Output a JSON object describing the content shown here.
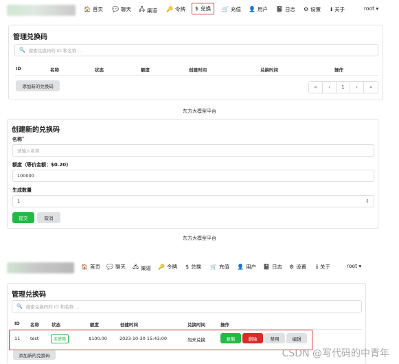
{
  "nav": {
    "items": [
      {
        "icon": "home-icon",
        "glyph": "🏠",
        "label": "首页"
      },
      {
        "icon": "chat-icon",
        "glyph": "💬",
        "label": "聊天"
      },
      {
        "icon": "sitemap-icon",
        "glyph": "🖧",
        "label": "渠道"
      },
      {
        "icon": "key-icon",
        "glyph": "🔑",
        "label": "令牌"
      },
      {
        "icon": "dollar-icon",
        "glyph": "$",
        "label": "兑换"
      },
      {
        "icon": "cart-icon",
        "glyph": "🛒",
        "label": "充值"
      },
      {
        "icon": "user-icon",
        "glyph": "👤",
        "label": "用户"
      },
      {
        "icon": "book-icon",
        "glyph": "📓",
        "label": "日志"
      },
      {
        "icon": "gear-icon",
        "glyph": "⚙",
        "label": "设置"
      },
      {
        "icon": "info-icon",
        "glyph": "ℹ",
        "label": "关于"
      }
    ],
    "user": "root ▾"
  },
  "manage": {
    "title": "管理兑换码",
    "search_placeholder": "搜索兑换码的 ID 和名称 ...",
    "columns": [
      "ID",
      "名称",
      "状态",
      "额度",
      "创建时间",
      "兑换时间",
      "操作"
    ],
    "add_button": "添加新的兑换码",
    "pager": [
      "«",
      "‹",
      "1",
      "›",
      "»"
    ]
  },
  "footer": "东方大模型平台",
  "create": {
    "title": "创建新的兑换码",
    "name_label": "名称",
    "name_required": "*",
    "name_placeholder": "请输入名称",
    "quota_label": "额度（等价金额：$0.20)",
    "quota_value": "100000",
    "count_label": "生成数量",
    "count_value": "1",
    "submit": "提交",
    "cancel": "取消"
  },
  "manage2": {
    "title": "管理兑换码",
    "search_placeholder": "搜索兑换码的 ID 和名称 ...",
    "columns": [
      "ID",
      "名称",
      "状态",
      "额度",
      "创建时间",
      "兑换时间",
      "操作"
    ],
    "row": {
      "id": "11",
      "name": "test",
      "status": "未使用",
      "quota": "$100.00",
      "created": "2023-10-30 15:43:00",
      "redeemed": "尚未兑换",
      "actions": [
        "复制",
        "删除",
        "禁用",
        "编辑"
      ]
    },
    "add_button": "添加新的兑换码"
  },
  "watermark": "CSDN @写代码的中青年",
  "colors": {
    "green": "#21ba45",
    "red": "#db2828",
    "highlight": "#e53935"
  }
}
